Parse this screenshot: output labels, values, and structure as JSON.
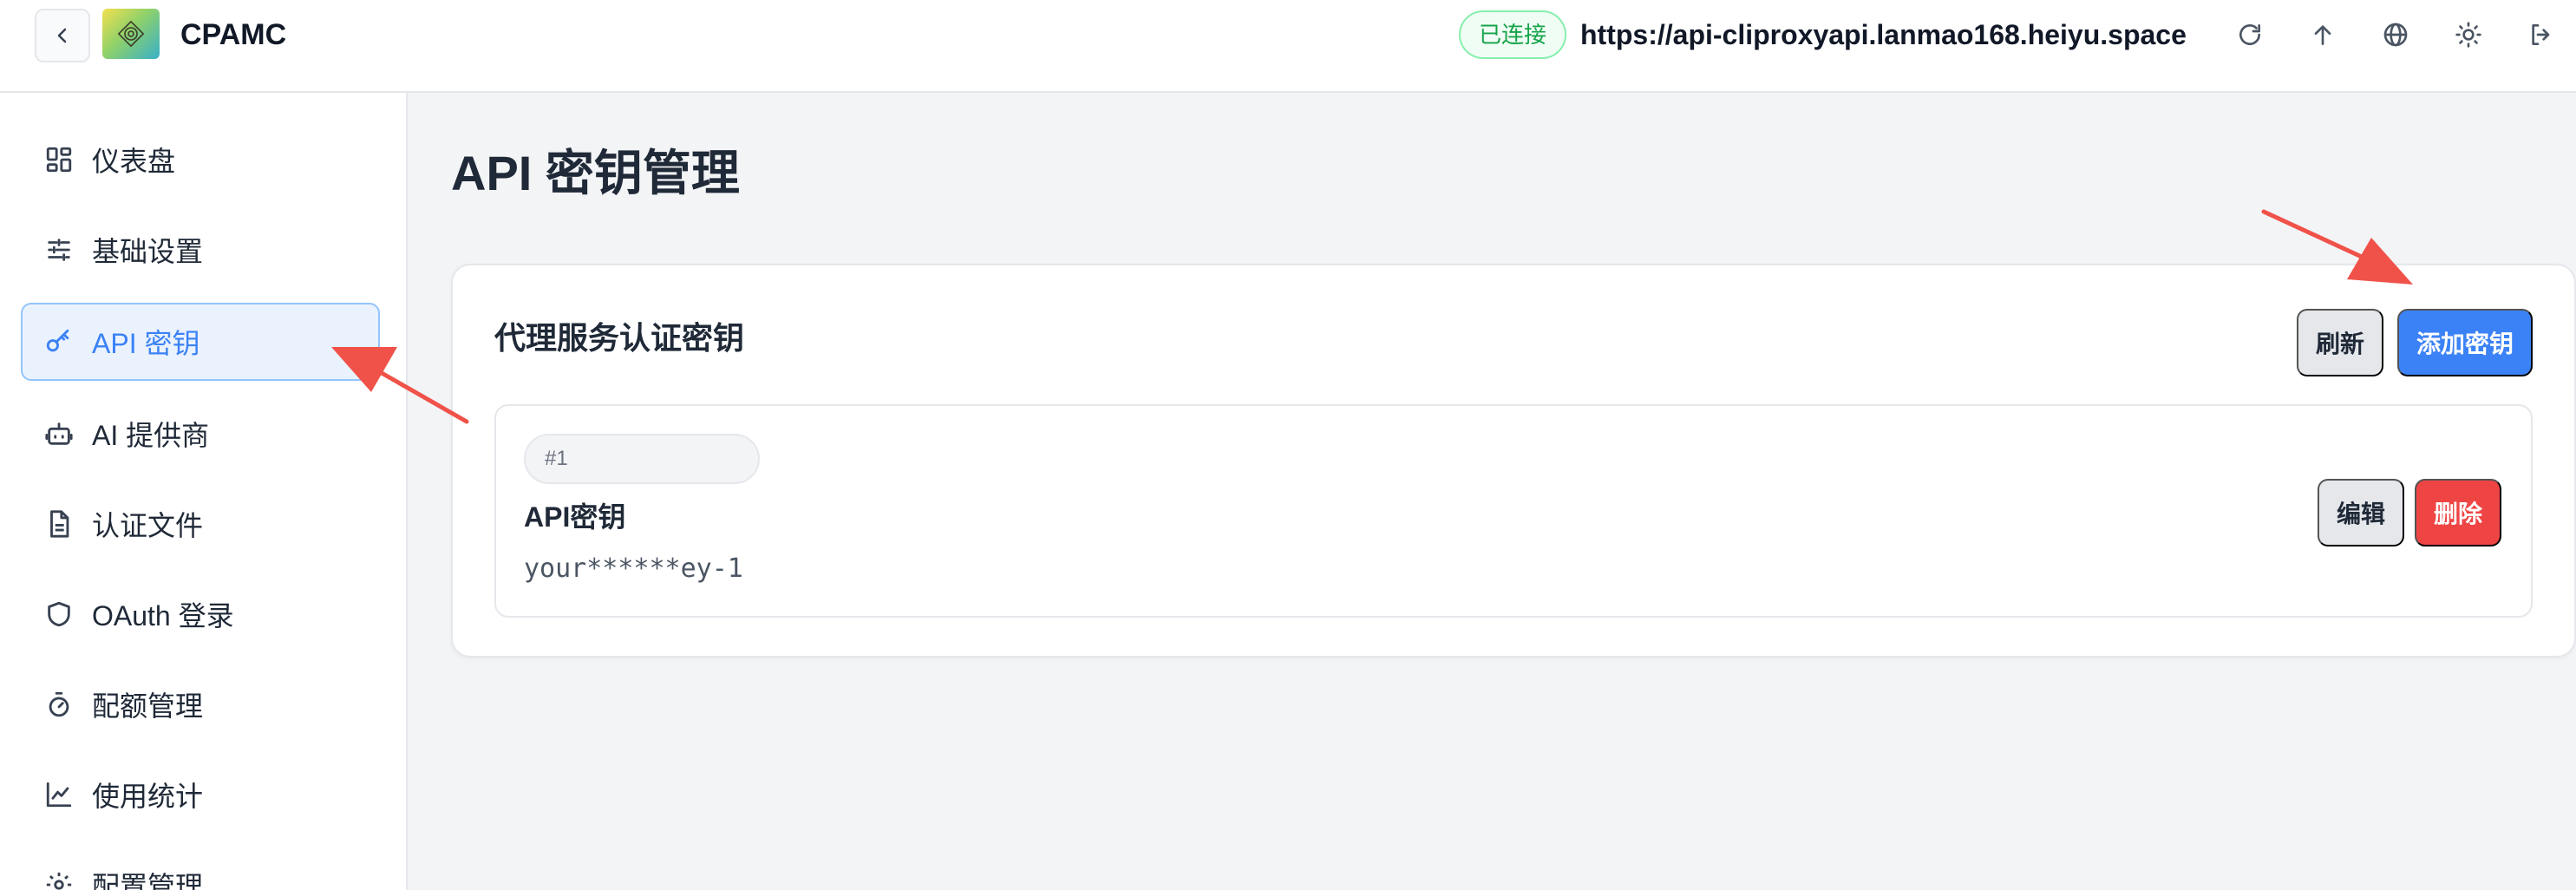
{
  "header": {
    "app_name": "CPAMC",
    "status": "已连接",
    "server_url": "https://api-cliproxyapi.lanmao168.heiyu.space",
    "icons": [
      "back-icon",
      "refresh-icon",
      "upload-icon",
      "globe-icon",
      "theme-sun-icon",
      "logout-icon"
    ]
  },
  "sidebar": {
    "items": [
      {
        "label": "仪表盘",
        "icon": "dashboard-icon"
      },
      {
        "label": "基础设置",
        "icon": "sliders-icon"
      },
      {
        "label": "API 密钥",
        "icon": "key-icon",
        "active": true
      },
      {
        "label": "AI 提供商",
        "icon": "robot-icon"
      },
      {
        "label": "认证文件",
        "icon": "file-icon"
      },
      {
        "label": "OAuth 登录",
        "icon": "shield-icon"
      },
      {
        "label": "配额管理",
        "icon": "timer-icon"
      },
      {
        "label": "使用统计",
        "icon": "chart-icon"
      },
      {
        "label": "配置管理",
        "icon": "gear-icon"
      }
    ]
  },
  "main": {
    "title": "API 密钥管理",
    "card": {
      "title": "代理服务认证密钥",
      "refresh_label": "刷新",
      "add_label": "添加密钥",
      "keys": [
        {
          "index": "#1",
          "name": "API密钥",
          "value": "your******ey-1",
          "edit_label": "编辑",
          "delete_label": "删除"
        }
      ]
    }
  },
  "colors": {
    "accent": "#3b82f6",
    "danger": "#ef4444",
    "success": "#16a34a",
    "annotation": "#f0524a"
  }
}
